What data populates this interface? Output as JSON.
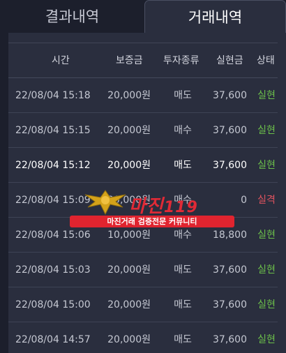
{
  "tabs": [
    {
      "label": "결과내역",
      "active": false
    },
    {
      "label": "거래내역",
      "active": true
    }
  ],
  "table": {
    "columns": [
      "시간",
      "보증금",
      "투자종류",
      "실현금",
      "상태"
    ],
    "rows": [
      {
        "time": "22/08/04 15:18",
        "deposit": "20,000원",
        "type": "매도",
        "amount": "37,600",
        "status": "실현",
        "status_color": "green"
      },
      {
        "time": "22/08/04 15:15",
        "deposit": "20,000원",
        "type": "매수",
        "amount": "37,600",
        "status": "실현",
        "status_color": "green"
      },
      {
        "time": "22/08/04 15:12",
        "deposit": "20,000원",
        "type": "매도",
        "amount": "37,600",
        "status": "실현",
        "status_color": "green"
      },
      {
        "time": "22/08/04 15:09",
        "deposit": "20,000원",
        "type": "매수",
        "amount": "0",
        "status": "실격",
        "status_color": "red"
      },
      {
        "time": "22/08/04 15:06",
        "deposit": "10,000원",
        "type": "매수",
        "amount": "18,800",
        "status": "실현",
        "status_color": "green"
      },
      {
        "time": "22/08/04 15:03",
        "deposit": "20,000원",
        "type": "매도",
        "amount": "37,600",
        "status": "실현",
        "status_color": "green"
      },
      {
        "time": "22/08/04 15:00",
        "deposit": "20,000원",
        "type": "매도",
        "amount": "37,600",
        "status": "실현",
        "status_color": "green"
      },
      {
        "time": "22/08/04 14:57",
        "deposit": "20,000원",
        "type": "매도",
        "amount": "37,600",
        "status": "실현",
        "status_color": "green"
      }
    ]
  },
  "watermark": {
    "logo_text": "마진",
    "logo_suffix": "119",
    "banner_text": "마진거래 검증전문 커뮤니티"
  },
  "colors": {
    "background": "#1c1f2c",
    "panel": "#2a2e3e",
    "status_green": "#6cc04a",
    "status_red": "#e0535f",
    "watermark_red": "#e0242f"
  }
}
